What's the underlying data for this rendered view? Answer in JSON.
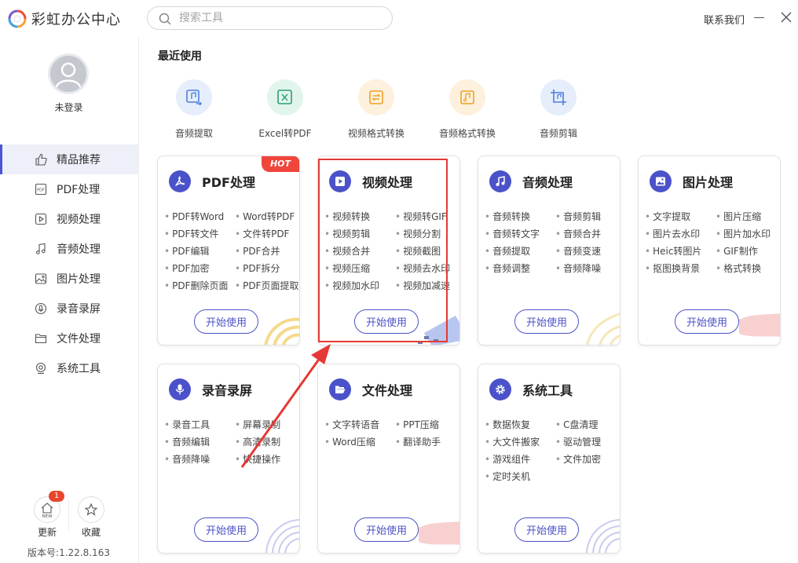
{
  "app": {
    "title": "彩虹办公中心"
  },
  "search": {
    "placeholder": "搜索工具"
  },
  "header": {
    "contact": "联系我们"
  },
  "user": {
    "status": "未登录"
  },
  "sidebar": {
    "items": [
      {
        "label": "精品推荐",
        "icon": "thumbs-up-icon",
        "active": true
      },
      {
        "label": "PDF处理",
        "icon": "pdf-icon"
      },
      {
        "label": "视频处理",
        "icon": "video-icon"
      },
      {
        "label": "音频处理",
        "icon": "music-icon"
      },
      {
        "label": "图片处理",
        "icon": "image-icon"
      },
      {
        "label": "录音录屏",
        "icon": "mic-icon"
      },
      {
        "label": "文件处理",
        "icon": "folder-icon"
      },
      {
        "label": "系统工具",
        "icon": "system-icon"
      }
    ],
    "footer": {
      "update_label": "更新",
      "update_badge": "1",
      "update_icon_text": "NEW",
      "favorite_label": "收藏",
      "version": "版本号:1.22.8.163"
    }
  },
  "recent": {
    "title": "最近使用",
    "items": [
      {
        "label": "音频提取",
        "icon": "audio-extract-icon",
        "color": "#4a7fe0",
        "bg": "#e6eefc"
      },
      {
        "label": "Excel转PDF",
        "icon": "excel-pdf-icon",
        "color": "#2aa06f",
        "bg": "#e2f5ec"
      },
      {
        "label": "视频格式转换",
        "icon": "video-convert-icon",
        "color": "#f0a020",
        "bg": "#fdf1de"
      },
      {
        "label": "音频格式转换",
        "icon": "audio-convert-icon",
        "color": "#f0a020",
        "bg": "#fdf1de"
      },
      {
        "label": "音频剪辑",
        "icon": "audio-cut-icon",
        "color": "#4a7fe0",
        "bg": "#e6eefc"
      }
    ]
  },
  "cards": [
    {
      "title": "PDF处理",
      "icon": "pdf-icon",
      "hot": "HOT",
      "button": "开始使用",
      "features": [
        "PDF转Word",
        "Word转PDF",
        "PDF转文件",
        "文件转PDF",
        "PDF编辑",
        "PDF合并",
        "PDF加密",
        "PDF拆分",
        "PDF删除页面",
        "PDF页面提取"
      ]
    },
    {
      "title": "视频处理",
      "icon": "play-icon",
      "button": "开始使用",
      "features": [
        "视频转换",
        "视频转GIF",
        "视频剪辑",
        "视频分割",
        "视频合并",
        "视频截图",
        "视频压缩",
        "视频去水印",
        "视频加水印",
        "视频加减速"
      ]
    },
    {
      "title": "音频处理",
      "icon": "music-note-icon",
      "button": "开始使用",
      "features": [
        "音频转换",
        "音频剪辑",
        "音频转文字",
        "音频合并",
        "音频提取",
        "音频变速",
        "音频调整",
        "音频降噪"
      ]
    },
    {
      "title": "图片处理",
      "icon": "picture-icon",
      "button": "开始使用",
      "features": [
        "文字提取",
        "图片压缩",
        "图片去水印",
        "图片加水印",
        "Heic转图片",
        "GIF制作",
        "抠图换背景",
        "格式转换"
      ]
    },
    {
      "title": "录音录屏",
      "icon": "microphone-icon",
      "button": "开始使用",
      "features": [
        "录音工具",
        "屏幕录制",
        "音频编辑",
        "高清录制",
        "音频降噪",
        "快捷操作"
      ]
    },
    {
      "title": "文件处理",
      "icon": "folder-open-icon",
      "button": "开始使用",
      "features": [
        "文字转语音",
        "PPT压缩",
        "Word压缩",
        "翻译助手"
      ]
    },
    {
      "title": "系统工具",
      "icon": "gear-icon",
      "button": "开始使用",
      "features": [
        "数据恢复",
        "C盘清理",
        "大文件搬家",
        "驱动管理",
        "游戏组件",
        "文件加密",
        "定时关机"
      ]
    }
  ],
  "colors": {
    "accent": "#4b52c9",
    "hot": "#f0453a",
    "annotation": "#e53935"
  }
}
